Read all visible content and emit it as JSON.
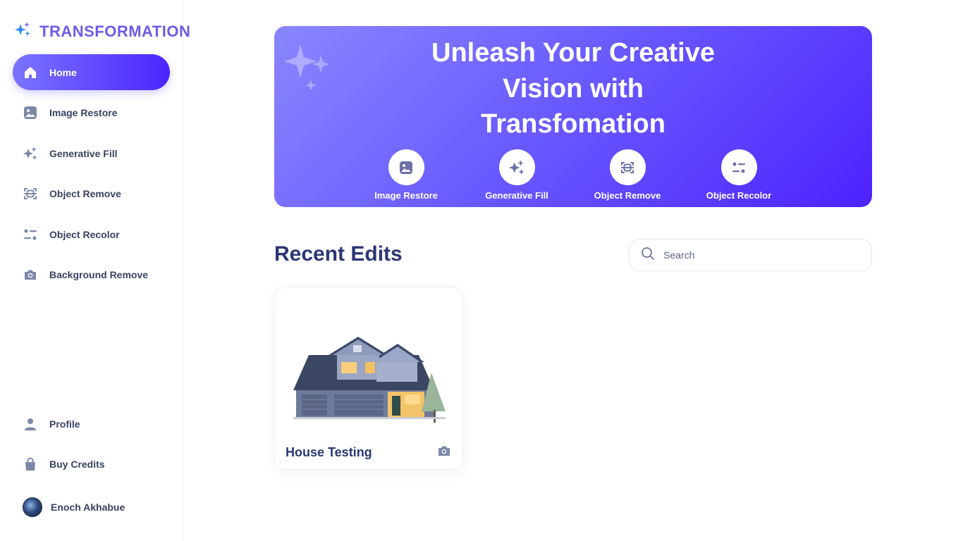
{
  "app": {
    "name": "TRANSFORMATION",
    "accent": "#6c5ce7",
    "gradient": [
      "#7b74ff",
      "#4b24ff"
    ]
  },
  "sidebar": {
    "items": [
      {
        "label": "Home",
        "icon": "home-icon",
        "active": true
      },
      {
        "label": "Image Restore",
        "icon": "image-icon",
        "active": false
      },
      {
        "label": "Generative Fill",
        "icon": "sparkles-icon",
        "active": false
      },
      {
        "label": "Object Remove",
        "icon": "scan-icon",
        "active": false
      },
      {
        "label": "Object Recolor",
        "icon": "filter-icon",
        "active": false
      },
      {
        "label": "Background Remove",
        "icon": "camera-icon",
        "active": false
      }
    ],
    "bottom_items": [
      {
        "label": "Profile",
        "icon": "user-icon"
      },
      {
        "label": "Buy Credits",
        "icon": "bag-icon"
      }
    ],
    "user": {
      "name": "Enoch Akhabue"
    }
  },
  "hero": {
    "title_lines": [
      "Unleash Your Creative",
      "Vision with",
      "Transfomation"
    ],
    "actions": [
      {
        "label": "Image Restore",
        "icon": "image-icon"
      },
      {
        "label": "Generative Fill",
        "icon": "sparkles-icon"
      },
      {
        "label": "Object Remove",
        "icon": "scan-icon"
      },
      {
        "label": "Object Recolor",
        "icon": "filter-icon"
      }
    ]
  },
  "recent": {
    "title": "Recent Edits",
    "search_placeholder": "Search",
    "items": [
      {
        "title": "House Testing",
        "icon": "camera-icon"
      }
    ]
  }
}
